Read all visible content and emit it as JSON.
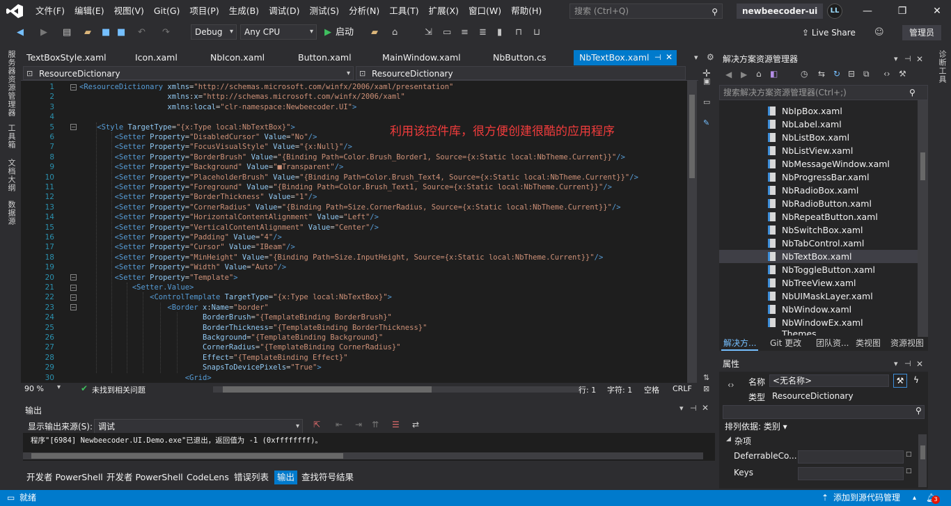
{
  "menu": {
    "items": [
      "文件(F)",
      "编辑(E)",
      "视图(V)",
      "Git(G)",
      "项目(P)",
      "生成(B)",
      "调试(D)",
      "测试(S)",
      "分析(N)",
      "工具(T)",
      "扩展(X)",
      "窗口(W)",
      "帮助(H)"
    ],
    "search_placeholder": "搜索 (Ctrl+Q)",
    "solution_name": "newbeecoder-ui",
    "user_initials": "LL"
  },
  "toolbar": {
    "config": "Debug",
    "platform": "Any CPU",
    "start_label": "启动",
    "live_share": "Live Share",
    "admin": "管理员"
  },
  "left_sidebar": [
    "服务器资源管理器",
    "工具箱",
    "文档大纲",
    "数据源"
  ],
  "right_sidebar": [
    "诊断工具"
  ],
  "doc_tabs": [
    {
      "label": "TextBoxStyle.xaml",
      "active": false
    },
    {
      "label": "Icon.xaml",
      "active": false
    },
    {
      "label": "NbIcon.xaml",
      "active": false
    },
    {
      "label": "Button.xaml",
      "active": false
    },
    {
      "label": "MainWindow.xaml",
      "active": false
    },
    {
      "label": "NbButton.cs",
      "active": false
    },
    {
      "label": "NbTextBox.xaml",
      "active": true
    }
  ],
  "nav": {
    "left": "ResourceDictionary",
    "right": "ResourceDictionary"
  },
  "caption": "利用该控件库，很方便创建很酷的应用程序",
  "code_lines": [
    [
      [
        "t",
        "<ResourceDictionary"
      ],
      [
        "a",
        " xmlns"
      ],
      [
        "v",
        "="
      ],
      [
        "q",
        "\"http://schemas.microsoft.com/winfx/2006/xaml/presentation\""
      ]
    ],
    [
      [
        "a",
        "                    xmlns"
      ],
      [
        "v",
        ":"
      ],
      [
        "a",
        "x"
      ],
      [
        "v",
        "="
      ],
      [
        "q",
        "\"http://schemas.microsoft.com/winfx/2006/xaml\""
      ]
    ],
    [
      [
        "a",
        "                    xmlns"
      ],
      [
        "v",
        ":"
      ],
      [
        "a",
        "local"
      ],
      [
        "v",
        "="
      ],
      [
        "q",
        "\"clr-namespace:Newbeecoder.UI\""
      ],
      [
        "t",
        ">"
      ]
    ],
    [],
    [
      [
        "t",
        "    <Style"
      ],
      [
        "a",
        " TargetType"
      ],
      [
        "v",
        "="
      ],
      [
        "q",
        "\"{x:Type local:NbTextBox}\""
      ],
      [
        "t",
        ">"
      ]
    ],
    [
      [
        "t",
        "        <Setter"
      ],
      [
        "a",
        " Property"
      ],
      [
        "v",
        "="
      ],
      [
        "q",
        "\"DisabledCursor\""
      ],
      [
        "a",
        " Value"
      ],
      [
        "v",
        "="
      ],
      [
        "q",
        "\"No\""
      ],
      [
        "t",
        "/>"
      ]
    ],
    [
      [
        "t",
        "        <Setter"
      ],
      [
        "a",
        " Property"
      ],
      [
        "v",
        "="
      ],
      [
        "q",
        "\"FocusVisualStyle\""
      ],
      [
        "a",
        " Value"
      ],
      [
        "v",
        "="
      ],
      [
        "q",
        "\"{x:Null}\""
      ],
      [
        "t",
        "/>"
      ]
    ],
    [
      [
        "t",
        "        <Setter"
      ],
      [
        "a",
        " Property"
      ],
      [
        "v",
        "="
      ],
      [
        "q",
        "\"BorderBrush\""
      ],
      [
        "a",
        " Value"
      ],
      [
        "v",
        "="
      ],
      [
        "q",
        "\"{Binding Path=Color.Brush_Border1, Source={x:Static local:NbTheme.Current}}\""
      ],
      [
        "t",
        "/>"
      ]
    ],
    [
      [
        "t",
        "        <Setter"
      ],
      [
        "a",
        " Property"
      ],
      [
        "v",
        "="
      ],
      [
        "q",
        "\"Background\""
      ],
      [
        "a",
        " Value"
      ],
      [
        "v",
        "="
      ],
      [
        "q",
        "\"■Transparent\""
      ],
      [
        "t",
        "/>"
      ]
    ],
    [
      [
        "t",
        "        <Setter"
      ],
      [
        "a",
        " Property"
      ],
      [
        "v",
        "="
      ],
      [
        "q",
        "\"PlaceholderBrush\""
      ],
      [
        "a",
        " Value"
      ],
      [
        "v",
        "="
      ],
      [
        "q",
        "\"{Binding Path=Color.Brush_Text4, Source={x:Static local:NbTheme.Current}}\""
      ],
      [
        "t",
        "/>"
      ]
    ],
    [
      [
        "t",
        "        <Setter"
      ],
      [
        "a",
        " Property"
      ],
      [
        "v",
        "="
      ],
      [
        "q",
        "\"Foreground\""
      ],
      [
        "a",
        " Value"
      ],
      [
        "v",
        "="
      ],
      [
        "q",
        "\"{Binding Path=Color.Brush_Text1, Source={x:Static local:NbTheme.Current}}\""
      ],
      [
        "t",
        "/>"
      ]
    ],
    [
      [
        "t",
        "        <Setter"
      ],
      [
        "a",
        " Property"
      ],
      [
        "v",
        "="
      ],
      [
        "q",
        "\"BorderThickness\""
      ],
      [
        "a",
        " Value"
      ],
      [
        "v",
        "="
      ],
      [
        "q",
        "\"1\""
      ],
      [
        "t",
        "/>"
      ]
    ],
    [
      [
        "t",
        "        <Setter"
      ],
      [
        "a",
        " Property"
      ],
      [
        "v",
        "="
      ],
      [
        "q",
        "\"CornerRadius\""
      ],
      [
        "a",
        " Value"
      ],
      [
        "v",
        "="
      ],
      [
        "q",
        "\"{Binding Path=Size.CornerRadius, Source={x:Static local:NbTheme.Current}}\""
      ],
      [
        "t",
        "/>"
      ]
    ],
    [
      [
        "t",
        "        <Setter"
      ],
      [
        "a",
        " Property"
      ],
      [
        "v",
        "="
      ],
      [
        "q",
        "\"HorizontalContentAlignment\""
      ],
      [
        "a",
        " Value"
      ],
      [
        "v",
        "="
      ],
      [
        "q",
        "\"Left\""
      ],
      [
        "t",
        "/>"
      ]
    ],
    [
      [
        "t",
        "        <Setter"
      ],
      [
        "a",
        " Property"
      ],
      [
        "v",
        "="
      ],
      [
        "q",
        "\"VerticalContentAlignment\""
      ],
      [
        "a",
        " Value"
      ],
      [
        "v",
        "="
      ],
      [
        "q",
        "\"Center\""
      ],
      [
        "t",
        "/>"
      ]
    ],
    [
      [
        "t",
        "        <Setter"
      ],
      [
        "a",
        " Property"
      ],
      [
        "v",
        "="
      ],
      [
        "q",
        "\"Padding\""
      ],
      [
        "a",
        " Value"
      ],
      [
        "v",
        "="
      ],
      [
        "q",
        "\"4\""
      ],
      [
        "t",
        "/>"
      ]
    ],
    [
      [
        "t",
        "        <Setter"
      ],
      [
        "a",
        " Property"
      ],
      [
        "v",
        "="
      ],
      [
        "q",
        "\"Cursor\""
      ],
      [
        "a",
        " Value"
      ],
      [
        "v",
        "="
      ],
      [
        "q",
        "\"IBeam\""
      ],
      [
        "t",
        "/>"
      ]
    ],
    [
      [
        "t",
        "        <Setter"
      ],
      [
        "a",
        " Property"
      ],
      [
        "v",
        "="
      ],
      [
        "q",
        "\"MinHeight\""
      ],
      [
        "a",
        " Value"
      ],
      [
        "v",
        "="
      ],
      [
        "q",
        "\"{Binding Path=Size.InputHeight, Source={x:Static local:NbTheme.Current}}\""
      ],
      [
        "t",
        "/>"
      ]
    ],
    [
      [
        "t",
        "        <Setter"
      ],
      [
        "a",
        " Property"
      ],
      [
        "v",
        "="
      ],
      [
        "q",
        "\"Width\""
      ],
      [
        "a",
        " Value"
      ],
      [
        "v",
        "="
      ],
      [
        "q",
        "\"Auto\""
      ],
      [
        "t",
        "/>"
      ]
    ],
    [
      [
        "t",
        "        <Setter"
      ],
      [
        "a",
        " Property"
      ],
      [
        "v",
        "="
      ],
      [
        "q",
        "\"Template\""
      ],
      [
        "t",
        ">"
      ]
    ],
    [
      [
        "t",
        "            <Setter.Value>"
      ]
    ],
    [
      [
        "t",
        "                <ControlTemplate"
      ],
      [
        "a",
        " TargetType"
      ],
      [
        "v",
        "="
      ],
      [
        "q",
        "\"{x:Type local:NbTextBox}\""
      ],
      [
        "t",
        ">"
      ]
    ],
    [
      [
        "t",
        "                    <Border"
      ],
      [
        "a",
        " x"
      ],
      [
        "v",
        ":"
      ],
      [
        "a",
        "Name"
      ],
      [
        "v",
        "="
      ],
      [
        "q",
        "\"border\""
      ]
    ],
    [
      [
        "a",
        "                            BorderBrush"
      ],
      [
        "v",
        "="
      ],
      [
        "q",
        "\"{TemplateBinding BorderBrush}\""
      ]
    ],
    [
      [
        "a",
        "                            BorderThickness"
      ],
      [
        "v",
        "="
      ],
      [
        "q",
        "\"{TemplateBinding BorderThickness}\""
      ]
    ],
    [
      [
        "a",
        "                            Background"
      ],
      [
        "v",
        "="
      ],
      [
        "q",
        "\"{TemplateBinding Background}\""
      ]
    ],
    [
      [
        "a",
        "                            CornerRadius"
      ],
      [
        "v",
        "="
      ],
      [
        "q",
        "\"{TemplateBinding CornerRadius}\""
      ]
    ],
    [
      [
        "a",
        "                            Effect"
      ],
      [
        "v",
        "="
      ],
      [
        "q",
        "\"{TemplateBinding Effect}\""
      ]
    ],
    [
      [
        "a",
        "                            SnapsToDevicePixels"
      ],
      [
        "v",
        "="
      ],
      [
        "q",
        "\"True\""
      ],
      [
        "t",
        ">"
      ]
    ],
    [
      [
        "t",
        "                        <Grid>"
      ]
    ]
  ],
  "editor_status": {
    "zoom": "90 %",
    "issues": "未找到相关问题",
    "line": "行: 1",
    "col": "字符: 1",
    "ws": "空格",
    "eol": "CRLF"
  },
  "output": {
    "title": "输出",
    "source_label": "显示输出来源(S):",
    "source_value": "调试",
    "text": "程序\"[6984] Newbeecoder.UI.Demo.exe\"已退出，返回值为 -1 (0xffffffff)。",
    "tabs": [
      {
        "label": "开发者 PowerShell",
        "active": false
      },
      {
        "label": "开发者 PowerShell",
        "active": false
      },
      {
        "label": "CodeLens",
        "active": false
      },
      {
        "label": "错误列表",
        "active": false
      },
      {
        "label": "输出",
        "active": true
      },
      {
        "label": "查找符号结果",
        "active": false
      }
    ]
  },
  "solution_explorer": {
    "title": "解决方案资源管理器",
    "search_placeholder": "搜索解决方案资源管理器(Ctrl+;)",
    "items": [
      {
        "label": "NbIpBox.xaml",
        "selected": false
      },
      {
        "label": "NbLabel.xaml",
        "selected": false
      },
      {
        "label": "NbListBox.xaml",
        "selected": false
      },
      {
        "label": "NbListView.xaml",
        "selected": false
      },
      {
        "label": "NbMessageWindow.xaml",
        "selected": false
      },
      {
        "label": "NbProgressBar.xaml",
        "selected": false
      },
      {
        "label": "NbRadioBox.xaml",
        "selected": false
      },
      {
        "label": "NbRadioButton.xaml",
        "selected": false
      },
      {
        "label": "NbRepeatButton.xaml",
        "selected": false
      },
      {
        "label": "NbSwitchBox.xaml",
        "selected": false
      },
      {
        "label": "NbTabControl.xaml",
        "selected": false
      },
      {
        "label": "NbTextBox.xaml",
        "selected": true
      },
      {
        "label": "NbToggleButton.xaml",
        "selected": false
      },
      {
        "label": "NbTreeView.xaml",
        "selected": false
      },
      {
        "label": "NbUIMaskLayer.xaml",
        "selected": false
      },
      {
        "label": "NbWindow.xaml",
        "selected": false
      },
      {
        "label": "NbWindowEx.xaml",
        "selected": false
      }
    ],
    "partial_item": "Themes",
    "tabs": [
      "解决方...",
      "Git 更改",
      "团队资...",
      "类视图",
      "资源视图"
    ]
  },
  "properties": {
    "title": "属性",
    "name_label": "名称",
    "name_value": "<无名称>",
    "type_label": "类型",
    "type_value": "ResourceDictionary",
    "sort_label": "排列依据: 类别 ▾",
    "category": "杂项",
    "rows": [
      "DeferrableCo...",
      "Keys"
    ]
  },
  "statusbar": {
    "left": "就绪",
    "source_control": "添加到源代码管理",
    "notifications": "3"
  }
}
